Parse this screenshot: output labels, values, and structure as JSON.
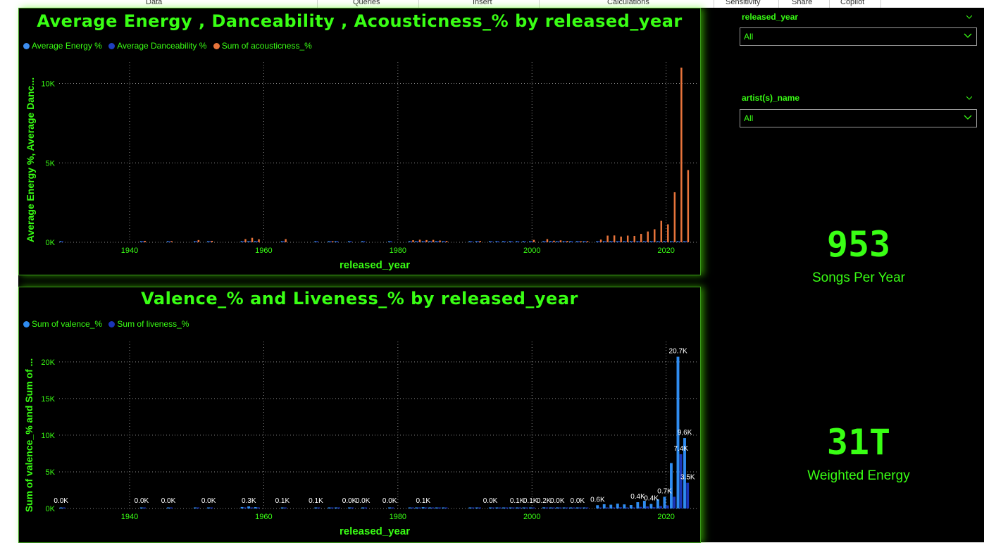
{
  "ribbon": {
    "tabs": [
      "Data",
      "Queries",
      "Insert",
      "Calculations",
      "Sensitivity",
      "Share",
      "Copilot"
    ]
  },
  "colors": {
    "neon_green": "#39ff14",
    "energy": "#3d8ef0",
    "danceability": "#1f3fbf",
    "acousticness": "#e8743b",
    "valence": "#2f8cf0",
    "liveness": "#1a34b8"
  },
  "slicers": [
    {
      "title": "released_year",
      "value": "All"
    },
    {
      "title": "artist(s)_name",
      "value": "All"
    }
  ],
  "cards": [
    {
      "value": "953",
      "label": "Songs Per Year"
    },
    {
      "value": "31T",
      "label": "Weighted Energy"
    }
  ],
  "chart_data": [
    {
      "type": "bar",
      "title": "Average Energy , Danceability , Acousticness_% by released_year",
      "xlabel": "released_year",
      "ylabel": "Average Energy %, Average Danc...",
      "xlim": [
        1929.5,
        2023.5
      ],
      "ylim": [
        0,
        11000
      ],
      "yticks": [
        0,
        5000,
        10000
      ],
      "ytick_labels": [
        "0K",
        "5K",
        "10K"
      ],
      "xticks": [
        1940,
        1960,
        1980,
        2000,
        2020
      ],
      "grid": true,
      "legend_position": "top-left",
      "series": [
        {
          "name": "Average Energy %",
          "color": "#3d8ef0",
          "x": [
            1930,
            1942,
            1946,
            1950,
            1952,
            1957,
            1958,
            1959,
            1963,
            1968,
            1970,
            1971,
            1973,
            1975,
            1979,
            1982,
            1983,
            1984,
            1985,
            1986,
            1987,
            1991,
            1992,
            1994,
            1995,
            1996,
            1997,
            1998,
            1999,
            2000,
            2002,
            2003,
            2004,
            2005,
            2006,
            2007,
            2008,
            2010,
            2011,
            2012,
            2013,
            2014,
            2015,
            2016,
            2017,
            2018,
            2019,
            2020,
            2021,
            2022,
            2023
          ],
          "values": [
            60,
            40,
            45,
            55,
            50,
            45,
            50,
            55,
            60,
            50,
            55,
            50,
            55,
            60,
            55,
            65,
            60,
            55,
            60,
            65,
            60,
            55,
            60,
            60,
            65,
            60,
            55,
            65,
            60,
            60,
            65,
            60,
            65,
            55,
            60,
            65,
            60,
            65,
            60,
            62,
            63,
            64,
            62,
            60,
            63,
            62,
            65,
            63,
            64,
            65,
            63
          ]
        },
        {
          "name": "Average Danceability %",
          "color": "#1f3fbf",
          "x": [
            1930,
            1942,
            1946,
            1950,
            1952,
            1957,
            1958,
            1959,
            1963,
            1968,
            1970,
            1971,
            1973,
            1975,
            1979,
            1982,
            1983,
            1984,
            1985,
            1986,
            1987,
            1991,
            1992,
            1994,
            1995,
            1996,
            1997,
            1998,
            1999,
            2000,
            2002,
            2003,
            2004,
            2005,
            2006,
            2007,
            2008,
            2010,
            2011,
            2012,
            2013,
            2014,
            2015,
            2016,
            2017,
            2018,
            2019,
            2020,
            2021,
            2022,
            2023
          ],
          "values": [
            55,
            45,
            50,
            60,
            55,
            50,
            55,
            50,
            55,
            55,
            60,
            55,
            60,
            65,
            60,
            60,
            65,
            60,
            60,
            62,
            58,
            60,
            62,
            64,
            60,
            62,
            65,
            60,
            64,
            66,
            62,
            64,
            60,
            66,
            62,
            64,
            66,
            62,
            64,
            66,
            63,
            65,
            64,
            62,
            66,
            65,
            67,
            68,
            66,
            67,
            69
          ]
        },
        {
          "name": "Sum of acousticness_%",
          "color": "#e8743b",
          "x": [
            1942,
            1946,
            1950,
            1952,
            1957,
            1958,
            1959,
            1963,
            1970,
            1982,
            1983,
            1984,
            1985,
            1986,
            1987,
            1992,
            2000,
            2002,
            2003,
            2004,
            2005,
            2007,
            2008,
            2010,
            2011,
            2012,
            2013,
            2014,
            2015,
            2016,
            2017,
            2018,
            2019,
            2020,
            2021,
            2022,
            2023
          ],
          "values": [
            90,
            70,
            140,
            90,
            200,
            280,
            190,
            200,
            60,
            130,
            160,
            140,
            150,
            110,
            80,
            80,
            150,
            200,
            100,
            120,
            80,
            50,
            70,
            170,
            420,
            430,
            360,
            420,
            400,
            530,
            680,
            820,
            1350,
            1130,
            3150,
            11000,
            4550
          ]
        }
      ]
    },
    {
      "type": "bar",
      "title": "Valence_% and Liveness_% by released_year",
      "xlabel": "released_year",
      "ylabel": "Sum of valence_% and Sum of ...",
      "xlim": [
        1929.5,
        2023.5
      ],
      "ylim": [
        0,
        22000
      ],
      "yticks": [
        0,
        5000,
        10000,
        15000,
        20000
      ],
      "ytick_labels": [
        "0K",
        "5K",
        "10K",
        "15K",
        "20K"
      ],
      "xticks": [
        1940,
        1960,
        1980,
        2000,
        2020
      ],
      "grid": true,
      "legend_position": "top-left",
      "series": [
        {
          "name": "Sum of valence_%",
          "color": "#2f8cf0",
          "x": [
            1930,
            1942,
            1946,
            1950,
            1952,
            1957,
            1958,
            1959,
            1963,
            1968,
            1970,
            1971,
            1973,
            1975,
            1979,
            1982,
            1983,
            1984,
            1985,
            1986,
            1987,
            1991,
            1992,
            1994,
            1995,
            1996,
            1997,
            1998,
            1999,
            2000,
            2002,
            2003,
            2004,
            2005,
            2006,
            2007,
            2008,
            2010,
            2011,
            2012,
            2013,
            2014,
            2015,
            2016,
            2017,
            2018,
            2019,
            2020,
            2021,
            2022,
            2023
          ],
          "values": [
            40,
            30,
            50,
            90,
            60,
            200,
            280,
            190,
            120,
            60,
            90,
            80,
            70,
            60,
            50,
            100,
            120,
            180,
            110,
            140,
            80,
            70,
            80,
            90,
            100,
            80,
            90,
            120,
            110,
            100,
            160,
            130,
            150,
            70,
            80,
            90,
            100,
            450,
            580,
            520,
            660,
            560,
            480,
            860,
            1050,
            620,
            1250,
            1600,
            6200,
            20700,
            9600
          ]
        },
        {
          "name": "Sum of liveness_%",
          "color": "#1a34b8",
          "x": [
            1930,
            1942,
            1946,
            1950,
            1952,
            1957,
            1958,
            1959,
            1963,
            1968,
            1970,
            1971,
            1973,
            1975,
            1979,
            1982,
            1983,
            1984,
            1985,
            1986,
            1987,
            1991,
            1992,
            1994,
            1995,
            1996,
            1997,
            1998,
            1999,
            2000,
            2002,
            2003,
            2004,
            2005,
            2006,
            2007,
            2008,
            2010,
            2011,
            2012,
            2013,
            2014,
            2015,
            2016,
            2017,
            2018,
            2019,
            2020,
            2021,
            2022,
            2023
          ],
          "values": [
            10,
            10,
            15,
            20,
            15,
            60,
            80,
            50,
            40,
            15,
            20,
            20,
            15,
            15,
            10,
            30,
            35,
            50,
            30,
            40,
            20,
            15,
            20,
            25,
            30,
            20,
            25,
            35,
            30,
            30,
            40,
            35,
            40,
            20,
            20,
            25,
            30,
            120,
            150,
            130,
            170,
            140,
            130,
            220,
            280,
            170,
            330,
            420,
            1600,
            7400,
            3500
          ]
        }
      ],
      "data_labels": [
        {
          "x": 1930,
          "text": "0.0K"
        },
        {
          "x": 1942,
          "text": "0.0K"
        },
        {
          "x": 1946,
          "text": "0.0K"
        },
        {
          "x": 1952,
          "text": "0.0K"
        },
        {
          "x": 1958,
          "text": "0.3K"
        },
        {
          "x": 1963,
          "text": "0.1K"
        },
        {
          "x": 1968,
          "text": "0.1K"
        },
        {
          "x": 1973,
          "text": "0.0K"
        },
        {
          "x": 1975,
          "text": "0.0K"
        },
        {
          "x": 1979,
          "text": "0.0K"
        },
        {
          "x": 1984,
          "text": "0.1K"
        },
        {
          "x": 1994,
          "text": "0.0K"
        },
        {
          "x": 1998,
          "text": "0.1K"
        },
        {
          "x": 2000,
          "text": "0.1K"
        },
        {
          "x": 2002,
          "text": "0.2K"
        },
        {
          "x": 2004,
          "text": "0.0K"
        },
        {
          "x": 2007,
          "text": "0.0K"
        },
        {
          "x": 2010,
          "text": "0.6K"
        },
        {
          "x": 2016,
          "text": "0.4K"
        },
        {
          "x": 2018,
          "text": "0.4K"
        },
        {
          "x": 2020,
          "text": "0.7K"
        },
        {
          "x": 2022,
          "text": "20.7K"
        },
        {
          "x": 2023,
          "text": "9.6K"
        },
        {
          "x": 2022,
          "text": "7.4K",
          "series": 1
        },
        {
          "x": 2023,
          "text": "3.5K",
          "series": 1
        }
      ]
    }
  ]
}
